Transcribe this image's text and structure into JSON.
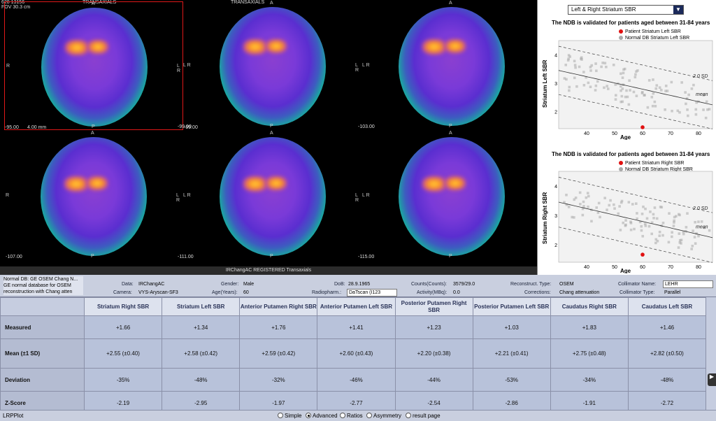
{
  "viewer": {
    "header_left": "628 13156",
    "header_center_1": "TRANSAXIALS",
    "header_center_2": "TRANSAXIALS",
    "fov": "FOV 30.3 cm",
    "scale": "4.00 mm",
    "orient": {
      "A": "A",
      "P": "P",
      "L": "L",
      "R": "R",
      "LR": "L R"
    },
    "slices": [
      {
        "pos": "-95.00",
        "sel": true
      },
      {
        "pos": "-99.00",
        "sel": false
      },
      {
        "pos": "-103.00",
        "sel": false
      },
      {
        "pos": "-107.00",
        "sel": false
      },
      {
        "pos": "-111.00",
        "sel": false
      },
      {
        "pos": "-115.00",
        "sel": false
      }
    ],
    "registered_label": "IRChangAC REGISTERED Transaxials"
  },
  "graphs": {
    "selector": "Left & Right Striatum SBR",
    "top": {
      "title": "The NDB is validated for patients aged between 31-84 years",
      "legend_patient": "Patient Striatum Left SBR",
      "legend_normal": "Normal DB Striatum Left SBR",
      "ylabel": "Striatum Left SBR",
      "xlabel": "Age",
      "yticks": [
        "4",
        "3",
        "2"
      ],
      "xticks": [
        "40",
        "50",
        "60",
        "70",
        "80"
      ],
      "sd_label": "2.0 SD",
      "mean_label": "mean",
      "patient": {
        "age": 60,
        "sbr": 1.34
      }
    },
    "bottom": {
      "title": "The NDB is validated for patients aged between 31-84 years",
      "legend_patient": "Patient Striatum Right SBR",
      "legend_normal": "Normal DB Striatum Right SBR",
      "ylabel": "Striatum Right SBR",
      "xlabel": "Age",
      "yticks": [
        "4",
        "3",
        "2"
      ],
      "xticks": [
        "40",
        "50",
        "60",
        "70",
        "80"
      ],
      "sd_label": "2.0 SD",
      "mean_label": "mean",
      "patient": {
        "age": 60,
        "sbr": 1.66
      }
    },
    "colors": {
      "patient": "#e01010",
      "normal": "#aaaaaa"
    }
  },
  "info": {
    "ndb_text": "Normal DB: GE OSEM Chang N... GE normal database for OSEM reconstruction with Chang atten",
    "data_label": "Data:",
    "data_value": "IRChangAC",
    "camera_label": "Camera:",
    "camera_value": "VYS-Aryscan-SF3",
    "gender_label": "Gender:",
    "gender_value": "Male",
    "age_label": "Age(Years):",
    "age_value": "60",
    "dob_label": "DoB:",
    "dob_value": "28.9.1965",
    "radio_label": "Radiopharm.:",
    "radio_value": "DaTscan (I123",
    "counts_label": "Counts(Counts):",
    "counts_value": "3579/29.0",
    "activity_label": "Activity(MBq):",
    "activity_value": "0.0",
    "recon_label": "Reconstruct. Type:",
    "recon_value": "OSEM",
    "corr_label": "Corrections:",
    "corr_value": "Chang attenuation",
    "collname_label": "Collimator Name:",
    "collname_value": "LEHR",
    "colltype_label": "Collimator Type:",
    "colltype_value": "Parallel"
  },
  "table": {
    "headers": [
      "Striatum Right SBR",
      "Striatum Left SBR",
      "Anterior Putamen Right SBR",
      "Anterior Putamen Left SBR",
      "Posterior Putamen Right SBR",
      "Posterior Putamen Left SBR",
      "Caudatus Right SBR",
      "Caudatus Left SBR"
    ],
    "rows": [
      {
        "label": "Measured",
        "values": [
          "+1.66",
          "+1.34",
          "+1.76",
          "+1.41",
          "+1.23",
          "+1.03",
          "+1.83",
          "+1.46"
        ]
      },
      {
        "label": "Mean (±1 SD)",
        "values": [
          "+2.55 (±0.40)",
          "+2.58 (±0.42)",
          "+2.59 (±0.42)",
          "+2.60 (±0.43)",
          "+2.20 (±0.38)",
          "+2.21 (±0.41)",
          "+2.75 (±0.48)",
          "+2.82 (±0.50)"
        ]
      },
      {
        "label": "Deviation",
        "values": [
          "-35%",
          "-48%",
          "-32%",
          "-46%",
          "-44%",
          "-53%",
          "-34%",
          "-48%"
        ]
      },
      {
        "label": "Z-Score",
        "values": [
          "-2.19",
          "-2.95",
          "-1.97",
          "-2.77",
          "-2.54",
          "-2.86",
          "-1.91",
          "-2.72"
        ]
      }
    ]
  },
  "bottombar": {
    "left_label": "LRPPlot",
    "radios": [
      {
        "label": "Simple",
        "checked": false
      },
      {
        "label": "Advanced",
        "checked": true
      },
      {
        "label": "Ratios",
        "checked": false
      },
      {
        "label": "Asymmetry",
        "checked": false
      },
      {
        "label": "result page",
        "checked": false
      }
    ],
    "pager_icon": "▶"
  }
}
